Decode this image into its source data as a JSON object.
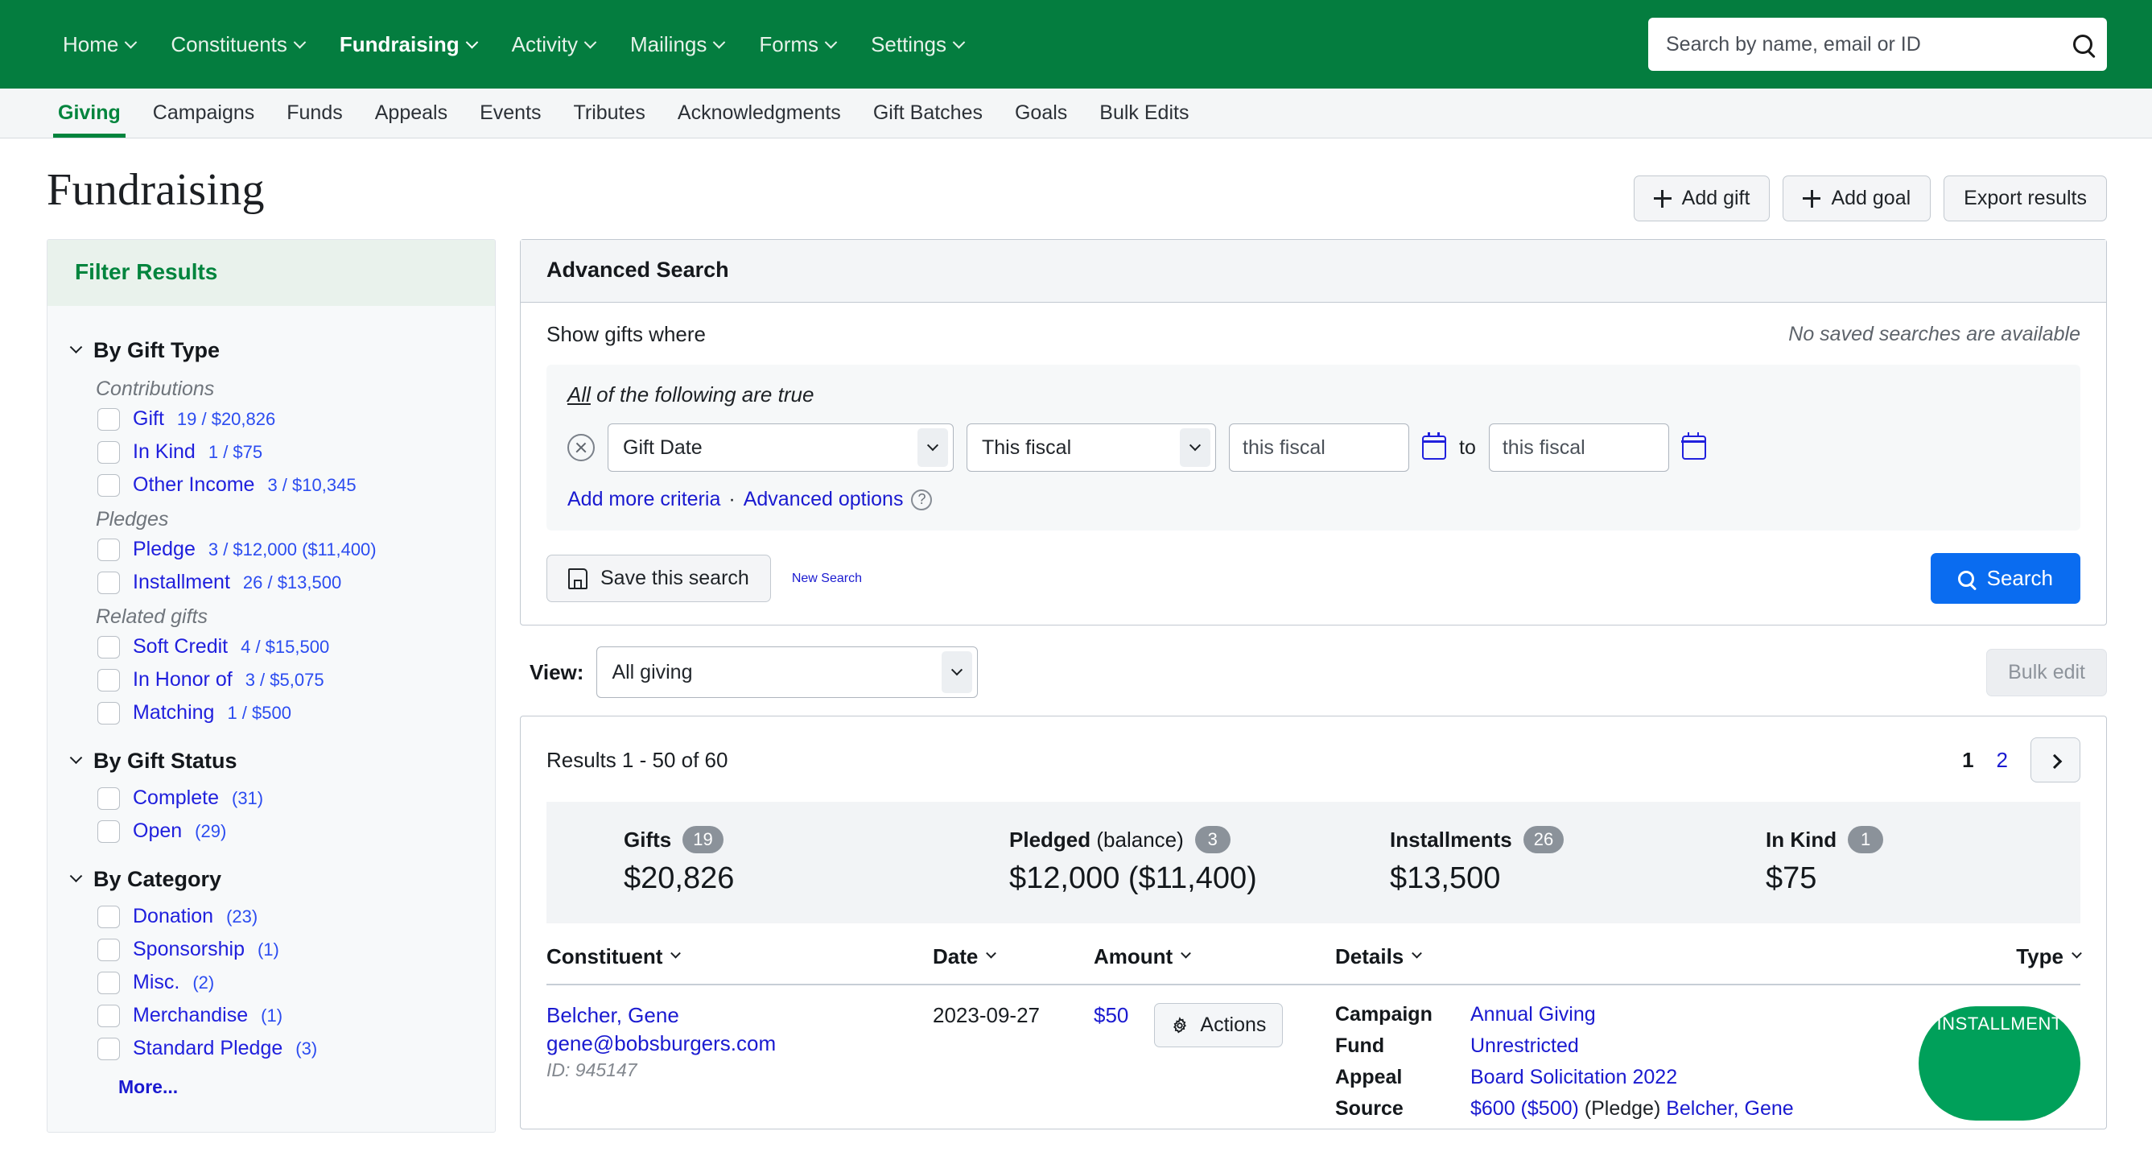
{
  "topnav": {
    "items": [
      {
        "label": "Home",
        "active": false
      },
      {
        "label": "Constituents",
        "active": false
      },
      {
        "label": "Fundraising",
        "active": true
      },
      {
        "label": "Activity",
        "active": false
      },
      {
        "label": "Mailings",
        "active": false
      },
      {
        "label": "Forms",
        "active": false
      },
      {
        "label": "Settings",
        "active": false
      }
    ],
    "search_placeholder": "Search by name, email or ID",
    "search_value": "",
    "brand_green": "#047d3f"
  },
  "subnav": {
    "items": [
      {
        "label": "Giving",
        "active": true
      },
      {
        "label": "Campaigns",
        "active": false
      },
      {
        "label": "Funds",
        "active": false
      },
      {
        "label": "Appeals",
        "active": false
      },
      {
        "label": "Events",
        "active": false
      },
      {
        "label": "Tributes",
        "active": false
      },
      {
        "label": "Acknowledgments",
        "active": false
      },
      {
        "label": "Gift Batches",
        "active": false
      },
      {
        "label": "Goals",
        "active": false
      },
      {
        "label": "Bulk Edits",
        "active": false
      }
    ]
  },
  "page": {
    "title": "Fundraising",
    "actions": [
      {
        "label": "Add gift",
        "icon": "plus-icon"
      },
      {
        "label": "Add goal",
        "icon": "plus-icon"
      },
      {
        "label": "Export results",
        "icon": ""
      }
    ]
  },
  "sidebar": {
    "title": "Filter Results",
    "facets": [
      {
        "title": "By Gift Type",
        "groups": [
          {
            "subtitle": "Contributions",
            "rows": [
              {
                "label": "Gift",
                "count": "19 / $20,826"
              },
              {
                "label": "In Kind",
                "count": "1 / $75"
              },
              {
                "label": "Other Income",
                "count": "3 / $10,345"
              }
            ]
          },
          {
            "subtitle": "Pledges",
            "rows": [
              {
                "label": "Pledge",
                "count": "3 / $12,000 ($11,400)"
              },
              {
                "label": "Installment",
                "count": "26 / $13,500"
              }
            ]
          },
          {
            "subtitle": "Related gifts",
            "rows": [
              {
                "label": "Soft Credit",
                "count": "4 / $15,500"
              },
              {
                "label": "In Honor of",
                "count": "3 / $5,075"
              },
              {
                "label": "Matching",
                "count": "1 / $500"
              }
            ]
          }
        ]
      },
      {
        "title": "By Gift Status",
        "groups": [
          {
            "subtitle": "",
            "rows": [
              {
                "label": "Complete",
                "count": "(31)"
              },
              {
                "label": "Open",
                "count": "(29)"
              }
            ]
          }
        ]
      },
      {
        "title": "By Category",
        "groups": [
          {
            "subtitle": "",
            "rows": [
              {
                "label": "Donation",
                "count": "(23)"
              },
              {
                "label": "Sponsorship",
                "count": "(1)"
              },
              {
                "label": "Misc.",
                "count": "(2)"
              },
              {
                "label": "Merchandise",
                "count": "(1)"
              },
              {
                "label": "Standard Pledge",
                "count": "(3)"
              }
            ]
          }
        ],
        "more_label": "More..."
      }
    ]
  },
  "advanced_search": {
    "header": "Advanced Search",
    "show_gifts_where": "Show gifts where",
    "no_saved_searches": "No saved searches are available",
    "all_true_prefix": "All",
    "all_true_rest": " of the following are true",
    "criteria": {
      "field": "Gift Date",
      "operator": "This fiscal",
      "from_value": "this fiscal",
      "to_word": "to",
      "to_value": "this fiscal"
    },
    "add_more_criteria": "Add more criteria",
    "separator": "·",
    "advanced_options": "Advanced options",
    "help_icon": "question-mark-icon",
    "save_this_search": "Save this search",
    "new_search": "New Search",
    "search_button": "Search",
    "search_button_color": "#0a6cf0"
  },
  "view_bar": {
    "label": "View:",
    "selected": "All giving",
    "bulk_edit": "Bulk edit"
  },
  "results": {
    "count_text": "Results 1 - 50 of 60",
    "pagination": {
      "pages": [
        "1",
        "2"
      ],
      "current": "1",
      "next_icon": "chevron-right-icon"
    },
    "summary": [
      {
        "label": "Gifts",
        "label_note": "",
        "badge": "19",
        "value": "$20,826"
      },
      {
        "label": "Pledged",
        "label_note": "(balance)",
        "badge": "3",
        "value": "$12,000 ($11,400)"
      },
      {
        "label": "Installments",
        "label_note": "",
        "badge": "26",
        "value": "$13,500"
      },
      {
        "label": "In Kind",
        "label_note": "",
        "badge": "1",
        "value": "$75"
      }
    ],
    "columns": [
      {
        "label": "Constituent",
        "sortable": true
      },
      {
        "label": "Date",
        "sortable": true
      },
      {
        "label": "Amount",
        "sortable": true
      },
      {
        "label": "Details",
        "sortable": true
      },
      {
        "label": "Type",
        "sortable": true
      }
    ],
    "rows": [
      {
        "constituent_name": "Belcher, Gene",
        "constituent_email": "gene@bobsburgers.com",
        "constituent_id": "ID: 945147",
        "date": "2023-09-27",
        "amount": "$50",
        "actions_label": "Actions",
        "details": [
          {
            "key": "Campaign",
            "value": "Annual Giving",
            "plain_suffix": ""
          },
          {
            "key": "Fund",
            "value": "Unrestricted",
            "plain_suffix": ""
          },
          {
            "key": "Appeal",
            "value": "Board Solicitation 2022",
            "plain_suffix": ""
          },
          {
            "key": "Source",
            "value": "$600 ($500)",
            "plain_mid": " (Pledge) ",
            "value2": "Belcher, Gene"
          }
        ],
        "type_badge": "INSTALLMENT",
        "type_badge_color": "#00a05a"
      }
    ]
  }
}
